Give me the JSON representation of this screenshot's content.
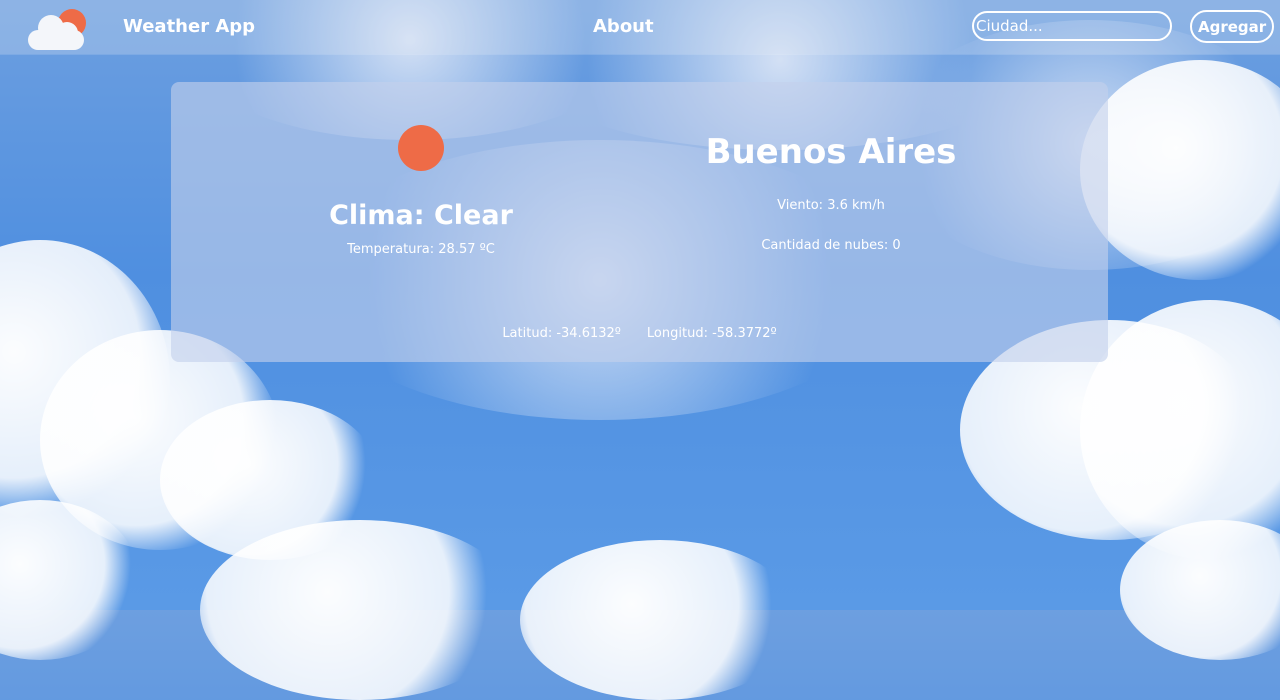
{
  "nav": {
    "brand": "Weather App",
    "about_label": "About",
    "search_placeholder": "Ciudad...",
    "search_value": "",
    "add_label": "Agregar"
  },
  "card": {
    "icon": "sun-icon",
    "clima_prefix": "Clima: ",
    "clima_value": "Clear",
    "temp_prefix": "Temperatura: ",
    "temp_value": "28.57 ºC",
    "city": "Buenos Aires",
    "wind_label": "Viento: ",
    "wind_value": "3.6 km/h",
    "clouds_label": "Cantidad de nubes: ",
    "clouds_value": "0",
    "lat_label": "Latitud: ",
    "lat_value": "-34.6132º",
    "lon_label": "Longitud: ",
    "lon_value": "-58.3772º"
  },
  "colors": {
    "accent": "#ee6b47",
    "sky": "#4f8fe0",
    "card": "#c4d0ec"
  }
}
